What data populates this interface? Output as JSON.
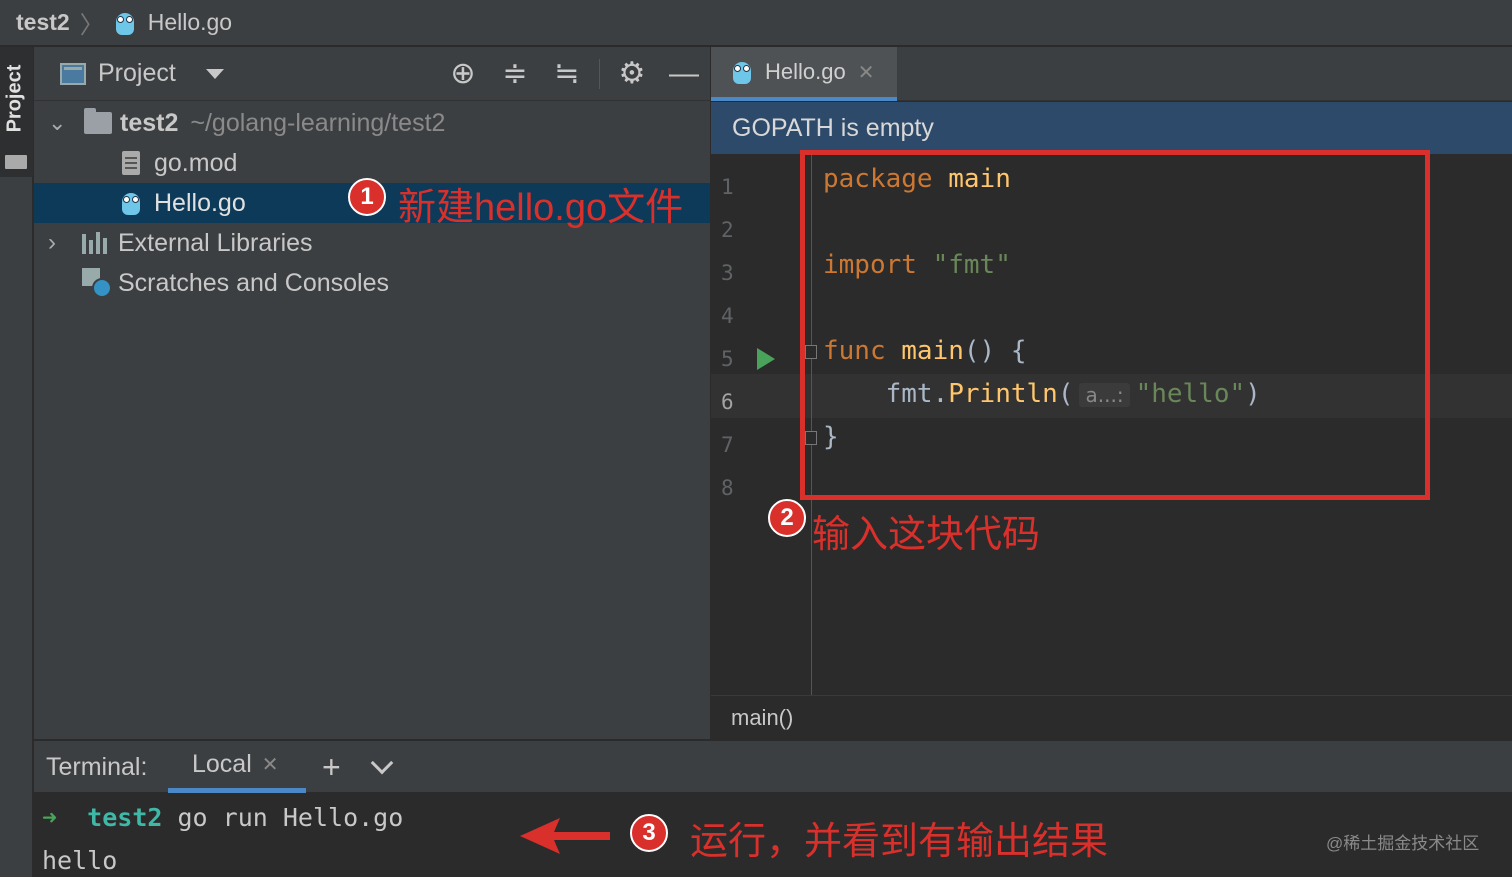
{
  "breadcrumb": {
    "root": "test2",
    "separator": "〉",
    "file": "Hello.go"
  },
  "tool_stripe": {
    "label": "Project"
  },
  "project_panel": {
    "title": "Project",
    "tree": {
      "root_name": "test2",
      "root_path": "~/golang-learning/test2",
      "files": [
        "go.mod",
        "Hello.go"
      ],
      "external_libraries": "External Libraries",
      "scratches": "Scratches and Consoles"
    }
  },
  "annotations": {
    "one": {
      "num": "1",
      "text": "新建hello.go文件"
    },
    "two": {
      "num": "2",
      "text": "输入这块代码"
    },
    "three": {
      "num": "3",
      "text": "运行，并看到有输出结果"
    }
  },
  "editor": {
    "tab_label": "Hello.go",
    "banner": "GOPATH is empty",
    "line_numbers": [
      "1",
      "2",
      "3",
      "4",
      "5",
      "6",
      "7",
      "8"
    ],
    "code": {
      "kw_package": "package",
      "pkg_name": "main",
      "kw_import": "import",
      "import_path": "\"fmt\"",
      "kw_func": "func",
      "fn_name": "main",
      "fn_sig": "() {",
      "call_pkg": "fmt.",
      "call_fn": "Println",
      "call_open": "(",
      "param_hint": "a...:",
      "arg": "\"hello\"",
      "call_close": ")",
      "close_brace": "}"
    },
    "status": "main()"
  },
  "terminal": {
    "title": "Terminal:",
    "tab_label": "Local",
    "prompt_arrow": "➜",
    "prompt_dir": "test2",
    "command": "go run Hello.go",
    "output": "hello"
  },
  "watermark": "@稀土掘金技术社区",
  "colors": {
    "annotation_red": "#d9302c",
    "selection": "#0d3a58",
    "banner": "#2e4a6b",
    "keyword": "#cc7832",
    "string": "#6a8759"
  }
}
